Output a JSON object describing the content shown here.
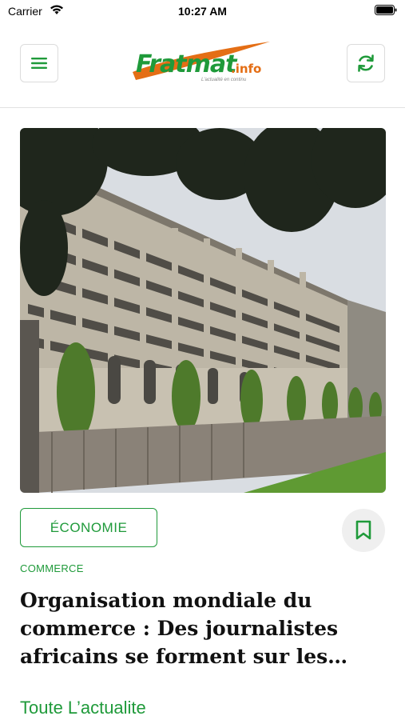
{
  "status_bar": {
    "carrier": "Carrier",
    "time": "10:27 AM"
  },
  "header": {
    "logo": {
      "text": "Fratmat",
      "suffix": ".info",
      "tagline": "L'actualité en continu"
    },
    "menu_icon": "hamburger-menu-icon",
    "refresh_icon": "refresh-icon"
  },
  "article": {
    "image_description": "building-photo",
    "category": "ÉCONOMIE",
    "subcategory": "COMMERCE",
    "title": "Organisation mondiale du commerce : Des journalistes africains se forment sur les…",
    "bookmark_icon": "bookmark-icon"
  },
  "section": {
    "label": "Toute L’actualite"
  },
  "colors": {
    "brand_green": "#1f9a3a",
    "brand_orange": "#e46e15"
  }
}
